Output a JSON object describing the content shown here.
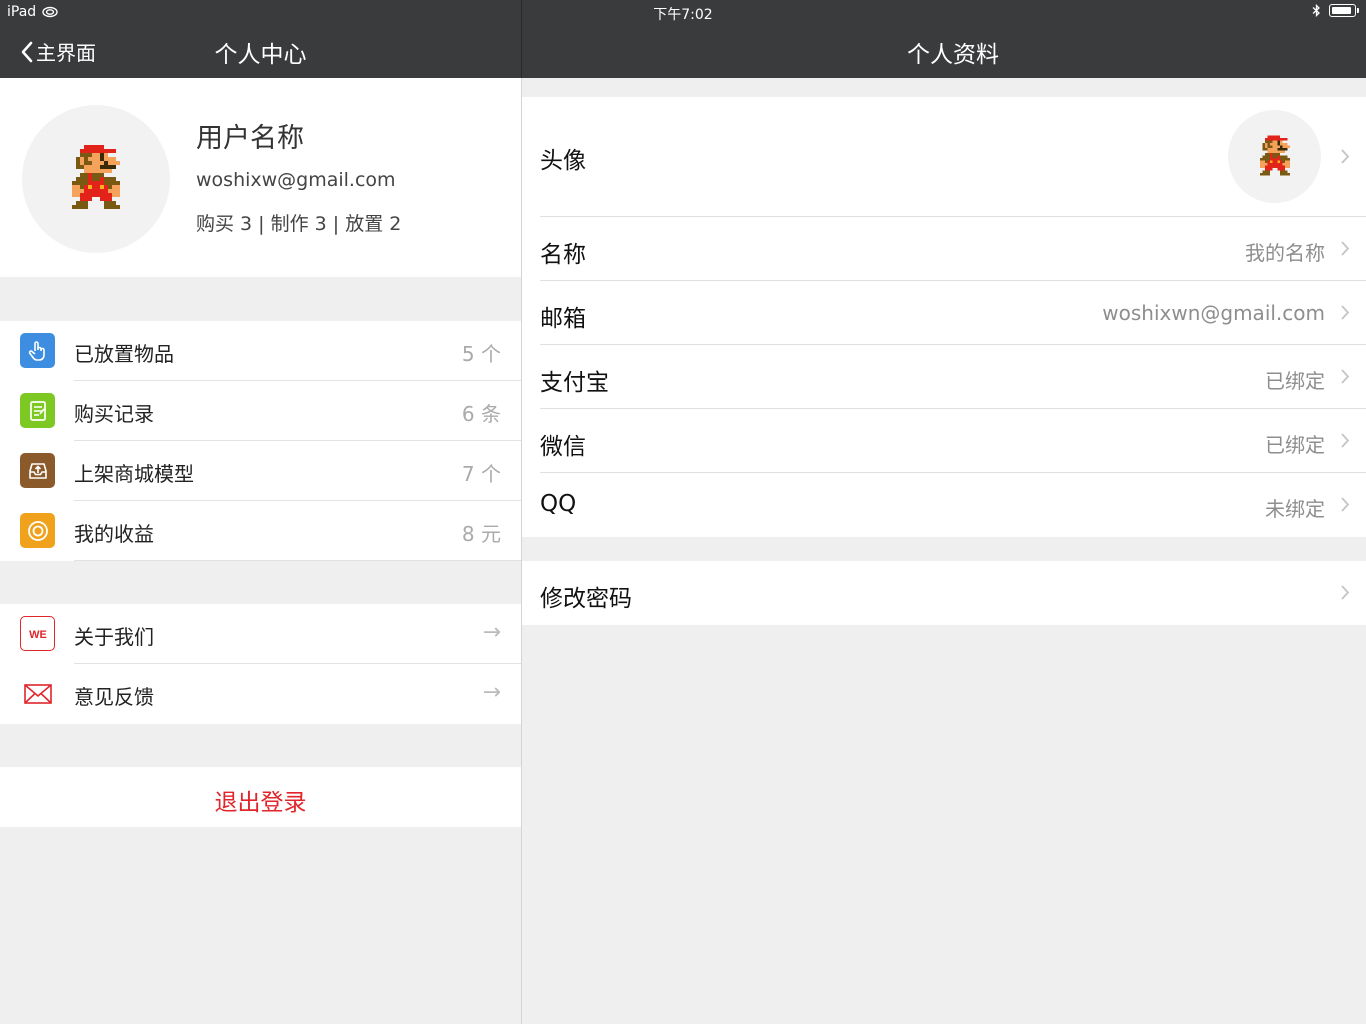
{
  "status": {
    "device": "iPad",
    "time": "下午7:02"
  },
  "left_nav": {
    "back_label": "主界面",
    "title": "个人中心"
  },
  "right_nav": {
    "title": "个人资料"
  },
  "profile": {
    "name": "用户名称",
    "email": "woshixw@gmail.com",
    "stats": "购买 3 | 制作 3 | 放置 2",
    "avatar": "pixel-mario-icon"
  },
  "menu_main": [
    {
      "label": "已放置物品",
      "value": "5 个",
      "icon": "hand-pointer-icon",
      "color": "#3d8ee0"
    },
    {
      "label": "购买记录",
      "value": "6 条",
      "icon": "notepad-icon",
      "color": "#7ec824"
    },
    {
      "label": "上架商城模型",
      "value": "7 个",
      "icon": "upload-tray-icon",
      "color": "#8b5a2b"
    },
    {
      "label": "我的收益",
      "value": "8 元",
      "icon": "coin-icon",
      "color": "#f0a21d"
    }
  ],
  "menu_secondary": [
    {
      "label": "关于我们",
      "icon": "we-logo-icon",
      "color": "#e0262b"
    },
    {
      "label": "意见反馈",
      "icon": "envelope-icon",
      "color": "#e0262b"
    }
  ],
  "logout_label": "退出登录",
  "profile_fields": {
    "avatar_label": "头像",
    "rows": [
      {
        "label": "名称",
        "value": "我的名称"
      },
      {
        "label": "邮箱",
        "value": "woshixwn@gmail.com"
      },
      {
        "label": "支付宝",
        "value": "已绑定"
      },
      {
        "label": "微信",
        "value": "已绑定"
      },
      {
        "label": "QQ",
        "value": "未绑定"
      }
    ],
    "change_password_label": "修改密码"
  },
  "colors": {
    "nav_bg": "#3a3b3d",
    "background": "#efefef",
    "logout": "#e0262b"
  }
}
